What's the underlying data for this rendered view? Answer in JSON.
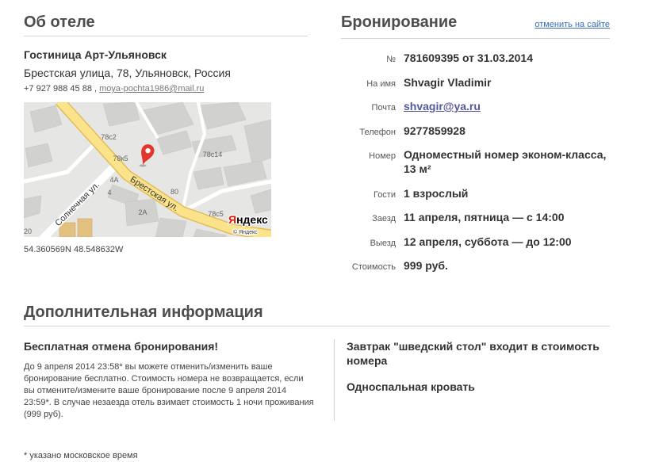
{
  "hotel": {
    "heading": "Об отеле",
    "name": "Гостиница Арт-Ульяновск",
    "address": "Брестская улица, 78, Ульяновск, Россия",
    "phone": "+7 927 988 45 88",
    "contact_separator": " , ",
    "email": "moya-pochta1986@mail.ru",
    "coordinates": "54.360569N 48.548632W",
    "map": {
      "house_labels": [
        "78с2",
        "78к5",
        "78с14",
        "4А",
        "4",
        "80",
        "2А",
        "20",
        "78с5"
      ],
      "streets": [
        "Брестская ул.",
        "Солнечная ул."
      ],
      "logo": "Яндекс",
      "copyright": "© Яндекс",
      "pin_icon": "map-pin-icon"
    }
  },
  "booking": {
    "heading": "Бронирование",
    "cancel_link": "отменить на сайте",
    "rows": [
      {
        "label": "№",
        "value": "781609395 от 31.03.2014"
      },
      {
        "label": "На имя",
        "value": "Shvagir Vladimir"
      },
      {
        "label": "Почта",
        "value": "shvagir@ya.ru"
      },
      {
        "label": "Телефон",
        "value": "9277859928"
      },
      {
        "label": "Номер",
        "value": "Одноместный номер эконом-класса, 13 м²"
      },
      {
        "label": "Гости",
        "value": "1 взрослый"
      },
      {
        "label": "Заезд",
        "value": "11 апреля, пятница — с 14:00"
      },
      {
        "label": "Выезд",
        "value": "12 апреля, суббота — до 12:00"
      },
      {
        "label": "Стоимость",
        "value": "999 руб."
      }
    ]
  },
  "extra": {
    "heading": "Дополнительная информация",
    "cancellation": {
      "title": "Бесплатная отмена бронирования!",
      "text_lines": [
        "До 9 апреля 2014 23:58* вы можете отменить/изменить ваше",
        "бронирование бесплатно. Стоимость номера не возвращается, если",
        "вы отмените/измените ваше бронирование после 9 апреля 2014",
        "23:59*. В случае незаезда отель взимает стоимость 1 ночи проживания",
        "(999 руб)."
      ]
    },
    "amenities": [
      "Завтрак \"шведский стол\" входит в стоимость номера",
      "Односпальная кровать"
    ]
  },
  "footnote": "* указано московское время",
  "colors": {
    "heading": "#4d4d4d",
    "text": "#333333",
    "link": "#3c6eb4",
    "guest_email_link": "#56589c",
    "rule": "#d4d4d4",
    "map_main_road": "#fbe38c",
    "map_pin": "#e3352e",
    "logo_red": "#e61400"
  }
}
